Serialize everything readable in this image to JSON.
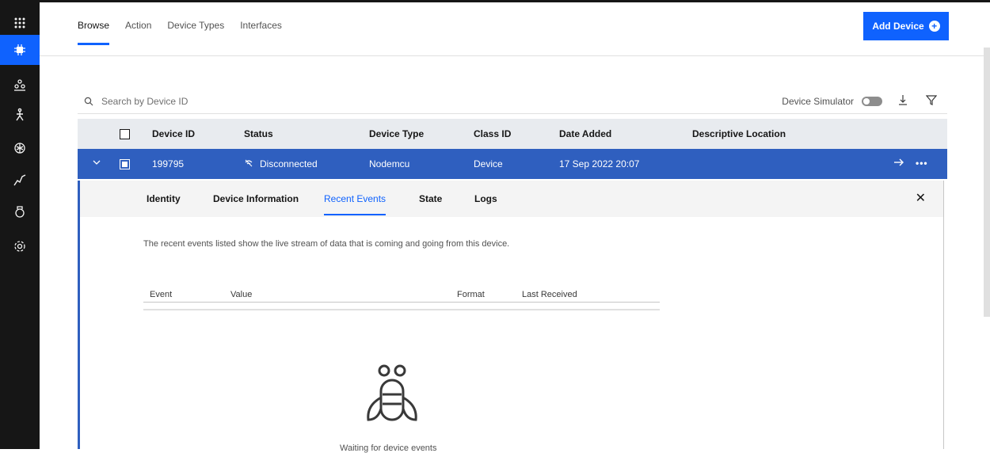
{
  "rail": {
    "items": [
      {
        "icon": "app-switcher-icon"
      },
      {
        "icon": "devices-chip-icon",
        "active": true
      },
      {
        "icon": "members-icon"
      },
      {
        "icon": "rules-icon"
      },
      {
        "icon": "security-icon"
      },
      {
        "icon": "usage-icon"
      },
      {
        "icon": "data-management-icon"
      },
      {
        "icon": "settings-icon"
      }
    ]
  },
  "tabs": {
    "browse": "Browse",
    "action": "Action",
    "device_types": "Device Types",
    "interfaces": "Interfaces"
  },
  "add_device": "Add Device",
  "search": {
    "placeholder": "Search by Device ID"
  },
  "simulator_label": "Device Simulator",
  "table": {
    "headers": {
      "device_id": "Device ID",
      "status": "Status",
      "device_type": "Device Type",
      "class_id": "Class ID",
      "date_added": "Date Added",
      "descriptive_location": "Descriptive Location"
    },
    "row": {
      "device_id": "199795",
      "status": "Disconnected",
      "device_type": "Nodemcu",
      "class_id": "Device",
      "date_added": "17 Sep 2022 20:07"
    }
  },
  "detail": {
    "tabs": {
      "identity": "Identity",
      "device_information": "Device Information",
      "recent_events": "Recent Events",
      "state": "State",
      "logs": "Logs"
    },
    "description": "The recent events listed show the live stream of data that is coming and going from this device.",
    "events_table": {
      "event": "Event",
      "value": "Value",
      "format": "Format",
      "last_received": "Last Received"
    },
    "empty_text": "Waiting for device events"
  },
  "colors": {
    "primary": "#0f62fe",
    "selected_row": "#2f5fbf",
    "rail_bg": "#161616"
  }
}
